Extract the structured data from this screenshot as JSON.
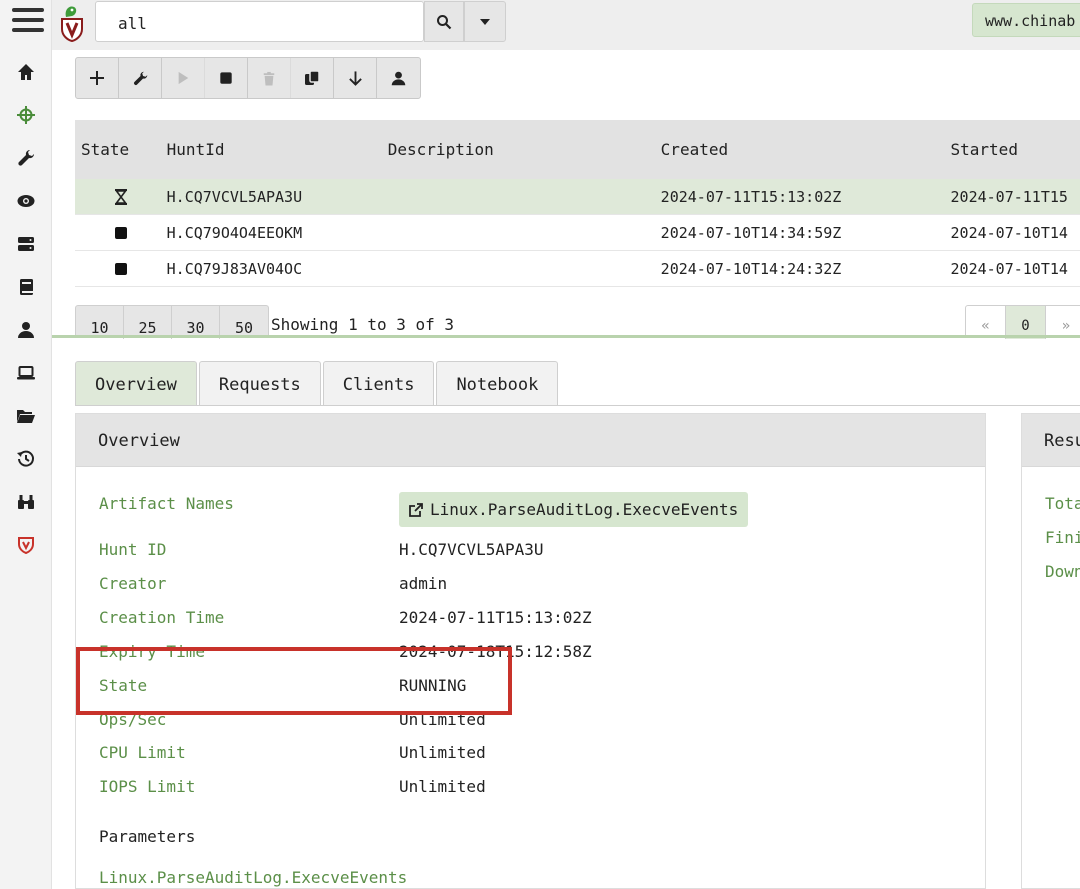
{
  "sidebar": {
    "items": [
      {
        "icon": "home-icon"
      },
      {
        "icon": "crosshair-icon",
        "active": true
      },
      {
        "icon": "wrench-icon"
      },
      {
        "icon": "eye-icon"
      },
      {
        "icon": "server-icon"
      },
      {
        "icon": "book-icon"
      },
      {
        "icon": "user-icon"
      },
      {
        "icon": "laptop-icon"
      },
      {
        "icon": "folder-open-icon"
      },
      {
        "icon": "history-icon"
      },
      {
        "icon": "binoculars-icon"
      },
      {
        "icon": "velociraptor-shield-icon"
      }
    ]
  },
  "search": {
    "value": "all"
  },
  "org": {
    "label": "www.chinab"
  },
  "toolbar": {
    "buttons": [
      "plus-icon",
      "wrench-icon",
      "play-icon",
      "stop-icon",
      "trash-icon",
      "copy-icon",
      "download-icon",
      "user-icon"
    ]
  },
  "hunts": {
    "columns": [
      "State",
      "HuntId",
      "Description",
      "Created",
      "Started"
    ],
    "rows": [
      {
        "state": "running",
        "id": "H.CQ7VCVL5APA3U",
        "description": "",
        "created": "2024-07-11T15:13:02Z",
        "started": "2024-07-11T15"
      },
      {
        "state": "stopped",
        "id": "H.CQ79O4O4EEOKM",
        "description": "",
        "created": "2024-07-10T14:34:59Z",
        "started": "2024-07-10T14"
      },
      {
        "state": "stopped",
        "id": "H.CQ79J83AV04OC",
        "description": "",
        "created": "2024-07-10T14:24:32Z",
        "started": "2024-07-10T14"
      }
    ]
  },
  "pager": {
    "sizes": [
      "10",
      "25",
      "30",
      "50"
    ],
    "showing": "Showing 1 to 3 of 3",
    "prev": "«",
    "current": "0",
    "next": "»"
  },
  "tabs": [
    "Overview",
    "Requests",
    "Clients",
    "Notebook"
  ],
  "overview": {
    "title": "Overview",
    "artifact_names_label": "Artifact Names",
    "artifact_name": "Linux.ParseAuditLog.ExecveEvents",
    "hunt_id_label": "Hunt ID",
    "hunt_id": "H.CQ7VCVL5APA3U",
    "creator_label": "Creator",
    "creator": "admin",
    "creation_time_label": "Creation Time",
    "creation_time": "2024-07-11T15:13:02Z",
    "expiry_time_label": "Expiry Time",
    "expiry_time": "2024-07-18T15:12:58Z",
    "state_label": "State",
    "state": "RUNNING",
    "ops_label": "Ops/Sec",
    "ops": "Unlimited",
    "cpu_label": "CPU Limit",
    "cpu": "Unlimited",
    "iops_label": "IOPS Limit",
    "iops": "Unlimited",
    "params_title": "Parameters",
    "params_link": "Linux.ParseAuditLog.ExecveEvents"
  },
  "results": {
    "title": "Resu",
    "items": [
      "Tota",
      "Fini",
      "Down"
    ]
  },
  "colors": {
    "accent_green": "#5b8f48",
    "selected_row": "#dfe9d9",
    "highlight_red": "#c8322a"
  }
}
